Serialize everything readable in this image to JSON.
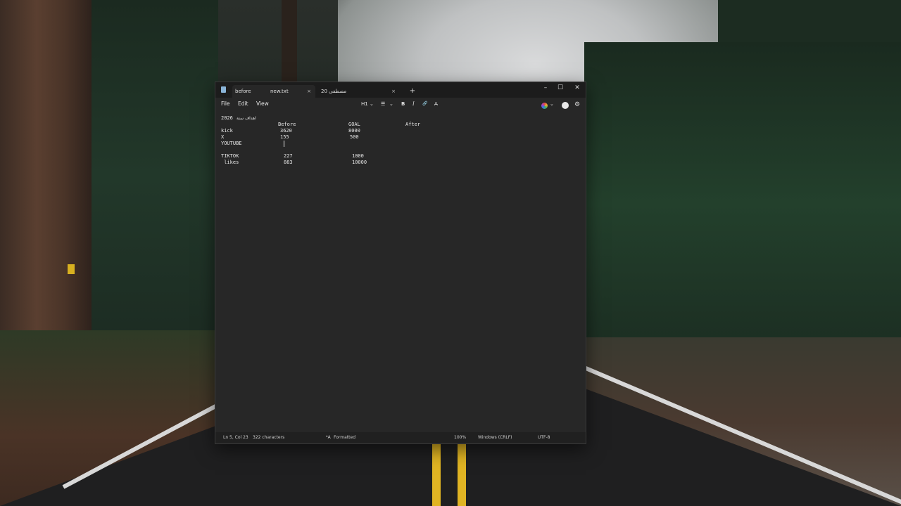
{
  "window": {
    "tabs": [
      {
        "label": "before",
        "title": "new.txt",
        "close": "×"
      },
      {
        "label": "20 مصطفى",
        "close": "×"
      }
    ],
    "new_tab": "+",
    "controls": {
      "minimize": "–",
      "maximize": "☐",
      "close": "✕"
    }
  },
  "menu": {
    "file": "File",
    "edit": "Edit",
    "view": "View"
  },
  "toolbar": {
    "heading": "H1",
    "heading_chevron": "⌄",
    "list": "☰",
    "list_chevron": "⌄",
    "bold": "B",
    "italic": "I",
    "link": "🔗",
    "clear": "A̶"
  },
  "document": {
    "title_year": "2026",
    "title_text": "اهداف سنة",
    "headers": {
      "before": "Before",
      "goal": "GOAL",
      "after": "After"
    },
    "rows": [
      {
        "name": "kick",
        "before": "3620",
        "goal": "8000"
      },
      {
        "name": "X",
        "before": "155",
        "goal": "500"
      },
      {
        "name": "YOUTUBE",
        "before": "",
        "goal": ""
      },
      {
        "name": "TIKTOK",
        "before": "227",
        "goal": "1000"
      },
      {
        "name": " likes",
        "before": "883",
        "goal": "10000"
      }
    ]
  },
  "status": {
    "position": "Ln 5, Col 23",
    "characters": "322 characters",
    "format_icon": "ᴬA",
    "format": "Formatted",
    "zoom": "100%",
    "line_ending": "Windows (CRLF)",
    "encoding": "UTF-8"
  },
  "colors": {
    "editor_bg": "#272727",
    "titlebar_bg": "#1c1c1c",
    "text": "#e8e8e8"
  }
}
